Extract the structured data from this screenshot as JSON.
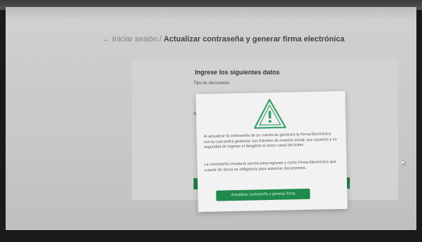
{
  "page": {
    "breadcrumb_back": "← Iniciar sesión /",
    "breadcrumb_current": "Actualizar contraseña y generar firma electrónica"
  },
  "form": {
    "title": "Ingrese los siguientes datos",
    "field_label": "Tipo de documento",
    "field_label_partial": "N"
  },
  "modal": {
    "icon": "warning-triangle-icon",
    "paragraph_1": "Al actualizar la contraseña de su cuenta se generará la Firma Electrónica con la cual podrá gestionar sus trámites de manera virtual, sus usuarios y su seguridad de ingreso el desglose al único canal del ticket.",
    "paragraph_2": "La contraseña creada le servirá para ingresar y como Firma Electrónica que a partir de ahora es obligatoria para autorizar documentos.",
    "button_label": "Actualizar contraseña y generar firma"
  },
  "colors": {
    "primary_green": "#1f8a4c",
    "footer_blue": "#2f5595"
  }
}
